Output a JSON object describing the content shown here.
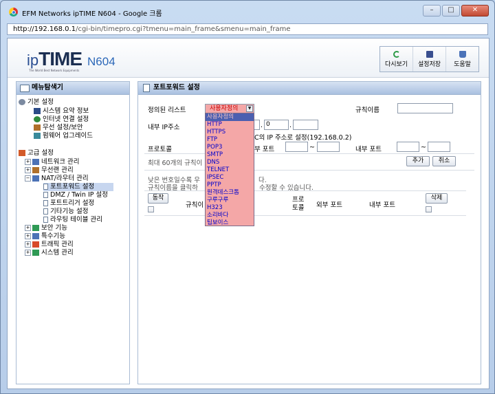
{
  "window": {
    "title": "EFM Networks ipTIME N604 - Google 크롬",
    "minimize": "–",
    "maximize": "□",
    "close": "✕"
  },
  "url": {
    "host": "http://192.168.0.1",
    "path": "/cgi-bin/timepro.cgi?tmenu=main_frame&smenu=main_frame"
  },
  "brand": {
    "ip": "ip",
    "time": "TIME",
    "model": "N604",
    "tagline": "The World Best Network Equipments"
  },
  "toolbar": {
    "refresh": "다시보기",
    "save": "설정저장",
    "help": "도움말"
  },
  "sidebar": {
    "title": "메뉴탐색기",
    "groups": [
      {
        "label": "기본 설정",
        "items": [
          "시스템 요약 정보",
          "인터넷 연결 설정",
          "무선 설정/보안",
          "펌웨어 업그레이드"
        ]
      },
      {
        "label": "고급 설정",
        "items": [
          "네트워크 관리",
          "무선랜 관리",
          "NAT/라우터 관리",
          "보안 기능",
          "특수기능",
          "트래픽 관리",
          "시스템 관리"
        ]
      }
    ],
    "nat_items": [
      "포트포워드 설정",
      "DMZ / Twin IP 설정",
      "포트트리거 설정",
      "기타기능 설정",
      "라우팅 테이블 관리"
    ],
    "plus": "+",
    "minus": "−"
  },
  "main": {
    "title": "포트포워드 설정",
    "predefined_label": "정의된 리스트",
    "predefined_value": "사용자정의",
    "predefined_arrow": "▼",
    "rule_name_label": "규칙이름",
    "internal_ip_label": "내부 IP주소",
    "ip_octet3": "0",
    "ip_dot": ".",
    "current_pc_note": "C의 IP 주소로 설정(192.168.0.2)",
    "protocol_label": "프로토콜",
    "external_port_label_partial": "부 포트",
    "tilde": "~",
    "internal_port_label": "내부 포트",
    "max_rules_partial": "최대 60개의 규칙이",
    "add_button": "추가",
    "cancel_button": "취소",
    "note1_left": "낮은 번호일수록 우",
    "note1_right": "다.",
    "note2_left": "규칙이름을 클릭하",
    "note2_right": "수정할 수 있습니다.",
    "col_action": "동작",
    "col_rule_partial": "규칙이",
    "col_protocol_1": "프로",
    "col_protocol_2": "토콜",
    "col_external": "외부 포트",
    "col_internal": "내부 포트",
    "delete_button": "삭제",
    "dropdown_options": [
      "사용자정의",
      "HTTP",
      "HTTPS",
      "FTP",
      "POP3",
      "SMTP",
      "DNS",
      "TELNET",
      "IPSEC",
      "PPTP",
      "원격데스크톱",
      "구루구루",
      "H323",
      "소리바다",
      "팁보이스"
    ]
  }
}
